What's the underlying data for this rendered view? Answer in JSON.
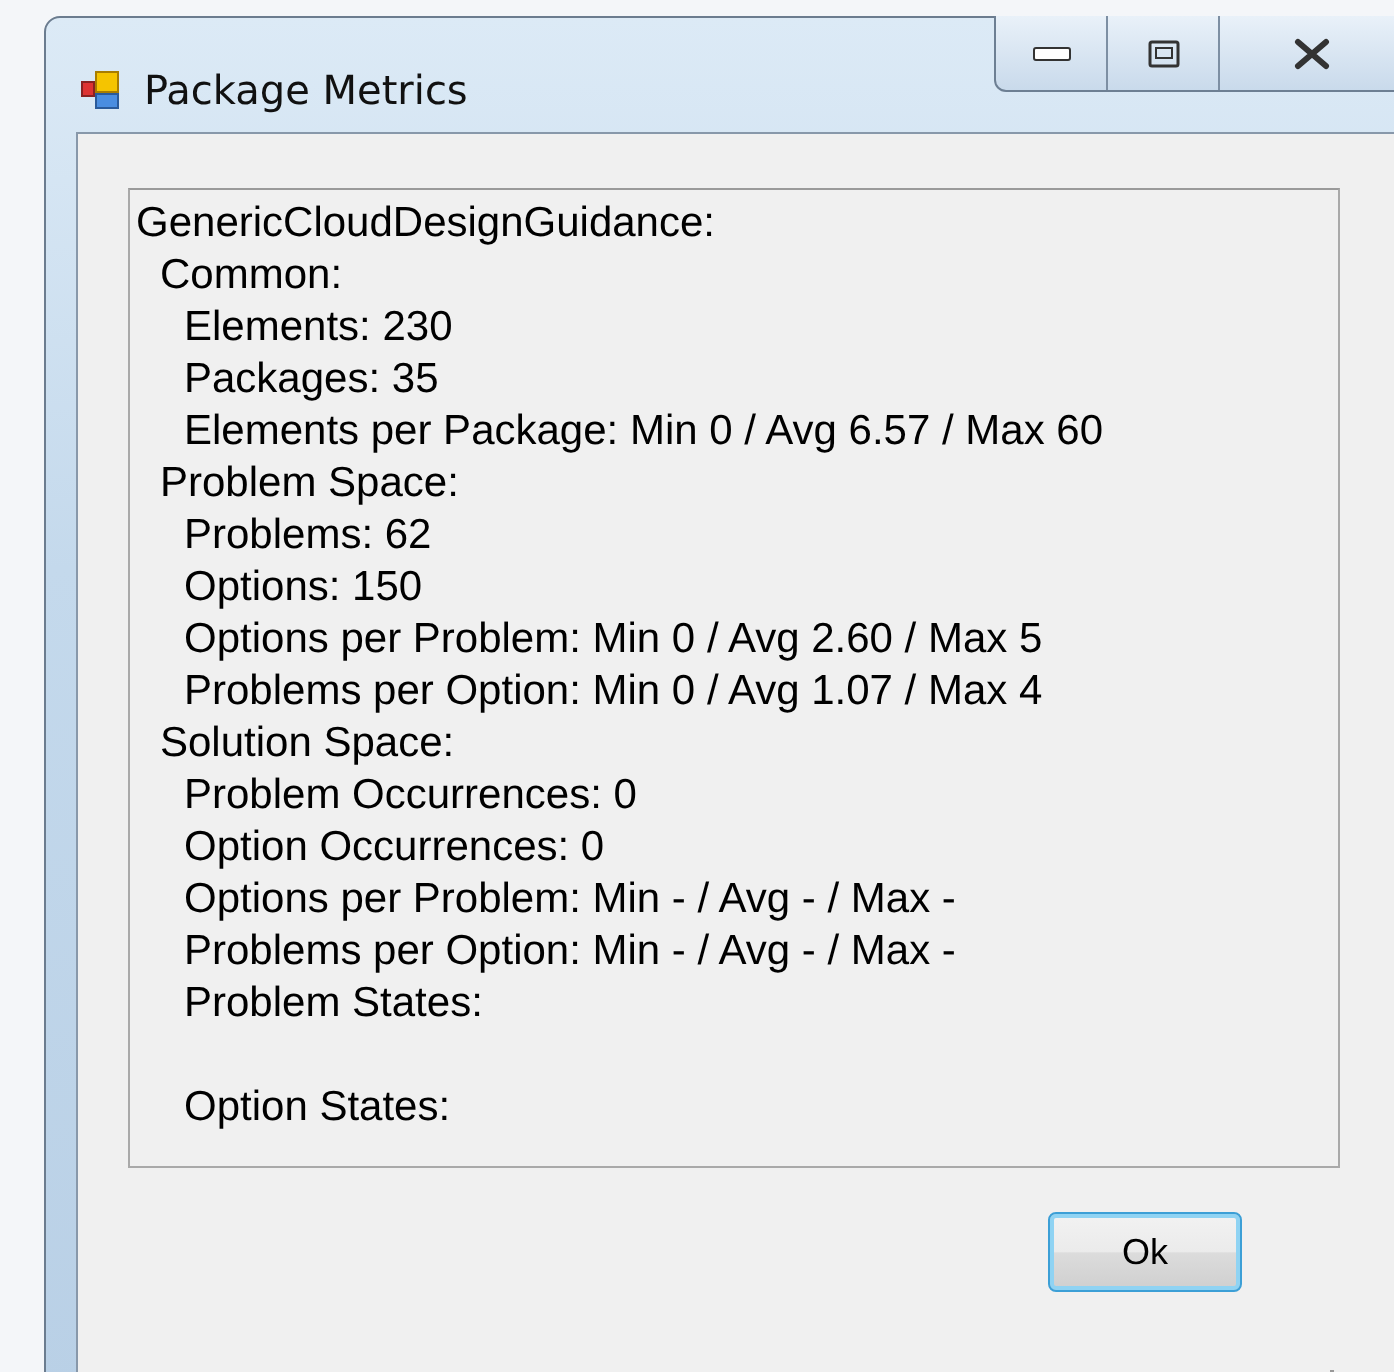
{
  "window": {
    "title": "Package Metrics"
  },
  "report": [
    {
      "text": "GenericCloudDesignGuidance:",
      "children": [
        {
          "text": "Common:",
          "children": [
            {
              "text": "Elements: 230"
            },
            {
              "text": "Packages: 35"
            },
            {
              "text": "Elements per Package: Min 0 / Avg 6.57 / Max 60"
            }
          ]
        },
        {
          "text": "Problem Space:",
          "children": [
            {
              "text": "Problems: 62"
            },
            {
              "text": "Options: 150"
            },
            {
              "text": "Options per Problem: Min 0 / Avg 2.60 / Max 5"
            },
            {
              "text": "Problems per Option: Min 0 / Avg 1.07 / Max 4"
            }
          ]
        },
        {
          "text": "Solution Space:",
          "children": [
            {
              "text": "Problem Occurrences: 0"
            },
            {
              "text": "Option Occurrences: 0"
            },
            {
              "text": "Options per Problem: Min - / Avg - / Max -"
            },
            {
              "text": "Problems per Option: Min - / Avg - / Max -"
            },
            {
              "text": "Problem States:",
              "blank_line_after": true
            },
            {
              "text": "Option States:"
            }
          ]
        }
      ]
    }
  ],
  "buttons": [
    {
      "label": "Ok"
    }
  ]
}
